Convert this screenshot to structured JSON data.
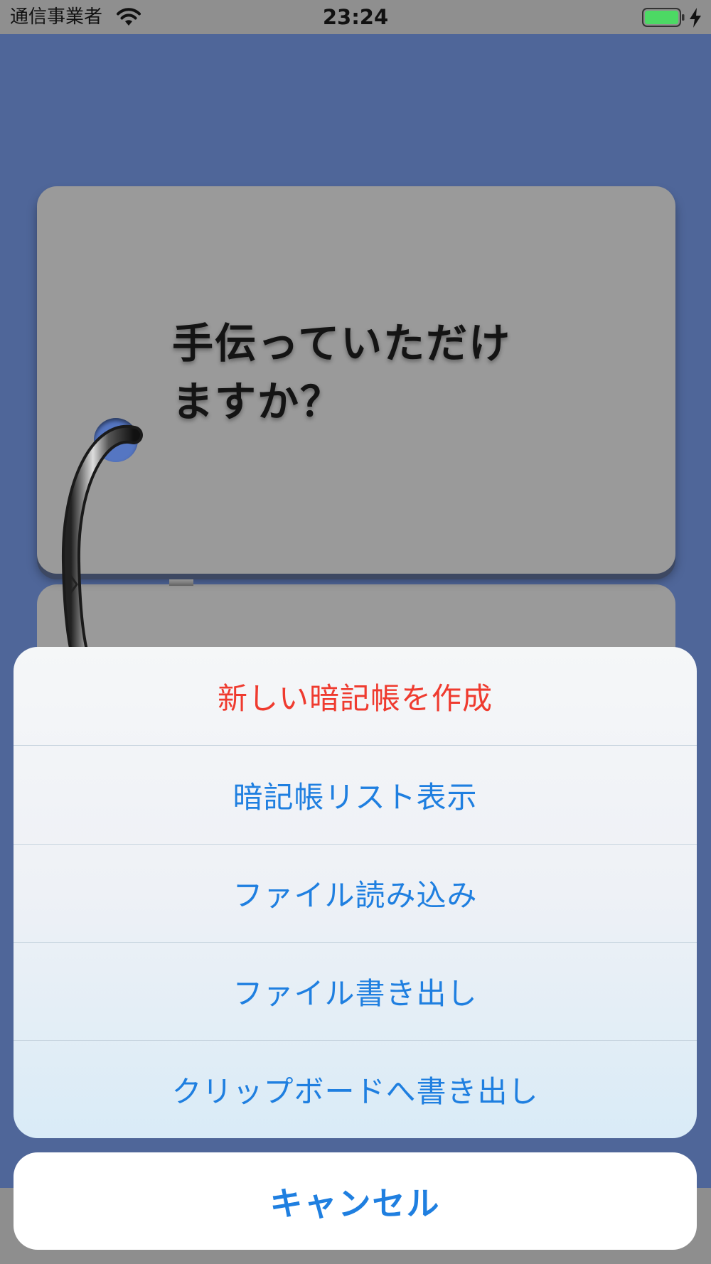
{
  "status_bar": {
    "carrier": "通信事業者",
    "time": "23:24",
    "wifi_icon": "wifi-icon",
    "battery_icon": "battery-icon",
    "charging_icon": "bolt-icon",
    "battery_color": "#4cd964"
  },
  "card": {
    "text": "手伝っていただけ\nますか？"
  },
  "action_sheet": {
    "items": [
      {
        "label": "新しい暗記帳を作成",
        "style": "destructive"
      },
      {
        "label": "暗記帳リスト表示",
        "style": "default"
      },
      {
        "label": "ファイル読み込み",
        "style": "default"
      },
      {
        "label": "ファイル書き出し",
        "style": "default"
      },
      {
        "label": "クリップボードへ書き出し",
        "style": "default"
      }
    ],
    "cancel_label": "キャンセル",
    "accent_color": "#1f7fe0",
    "destructive_color": "#ef3b2f"
  }
}
